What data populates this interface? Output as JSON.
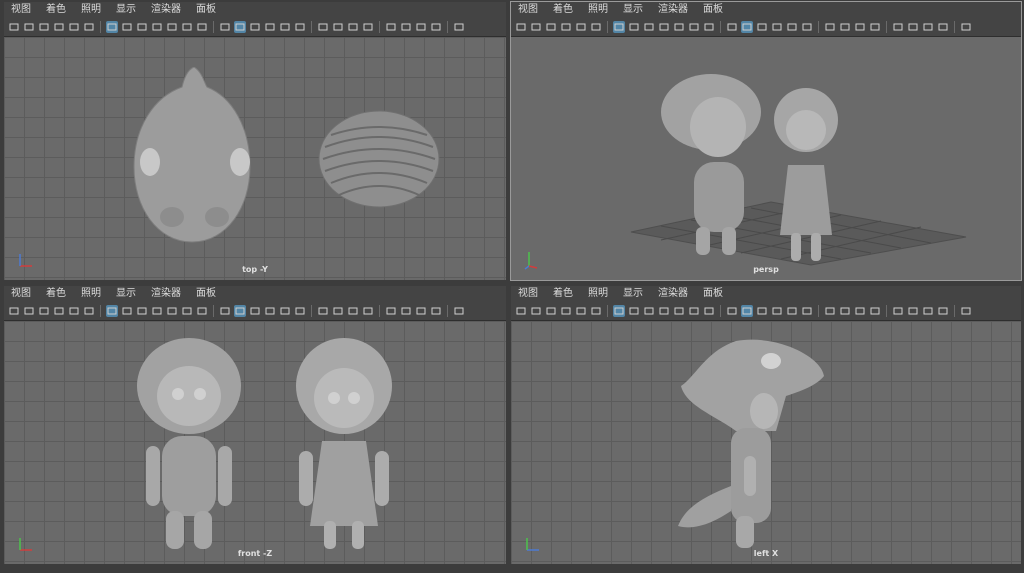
{
  "menu": [
    "视图",
    "着色",
    "照明",
    "显示",
    "渲染器",
    "面板"
  ],
  "viewports": [
    {
      "id": "tl",
      "label": "top -Y"
    },
    {
      "id": "tr",
      "label": "persp"
    },
    {
      "id": "bl",
      "label": "front -Z"
    },
    {
      "id": "br",
      "label": "left X"
    }
  ],
  "toolbar_icons": [
    "camera-icon",
    "camera-attr-icon",
    "bookmark-icon",
    "image-plane-icon",
    "2d-pan-icon",
    "grease-pencil-icon",
    "sep",
    "grid-icon",
    "film-gate-icon",
    "resolution-gate-icon",
    "gate-mask-icon",
    "field-chart-icon",
    "safe-action-icon",
    "safe-title-icon",
    "sep",
    "wireframe-icon",
    "smooth-shade-icon",
    "default-material-icon",
    "textured-icon",
    "xray-icon",
    "lights-icon",
    "sep",
    "shadows-icon",
    "ambient-occlusion-icon",
    "motion-blur-icon",
    "anti-alias-icon",
    "sep",
    "isolate-icon",
    "xray-joints-icon",
    "xray-active-icon",
    "backface-icon",
    "sep",
    "settings-icon"
  ],
  "colors": {
    "viewport_bg": "#6a6a6a",
    "grid_line": "#5c5c5c",
    "toolbar_bg": "#444444",
    "active_icon": "#5285a6",
    "axis_x": "#d23c3c",
    "axis_y": "#4cc24c",
    "axis_z": "#4c7bd2"
  }
}
